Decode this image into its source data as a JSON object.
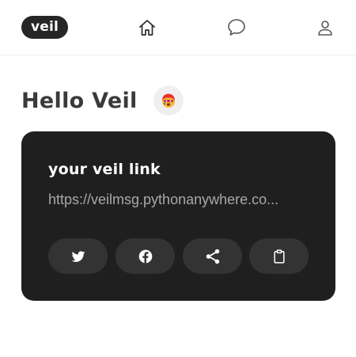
{
  "navbar": {
    "logo_text": "veil",
    "items": [
      {
        "name": "home",
        "icon": "home-icon"
      },
      {
        "name": "messages",
        "icon": "chat-bubble-icon"
      },
      {
        "name": "profile",
        "icon": "user-icon"
      }
    ]
  },
  "main": {
    "greeting": "Hello Veil",
    "avatar_icon": "red-haired-face-emoji-icon"
  },
  "card": {
    "title": "your veil link",
    "link": "https://veilmsg.pythonanywhere.co...",
    "buttons": [
      {
        "name": "twitter",
        "icon": "twitter-icon"
      },
      {
        "name": "facebook",
        "icon": "facebook-icon"
      },
      {
        "name": "share",
        "icon": "share-icon"
      },
      {
        "name": "copy",
        "icon": "clipboard-icon"
      }
    ]
  },
  "colors": {
    "card_bg": "#1f1f1f",
    "button_bg": "#333333",
    "logo_bg": "#262626",
    "text_dark": "#3a3a3a",
    "link_text": "#a8a8a8"
  }
}
